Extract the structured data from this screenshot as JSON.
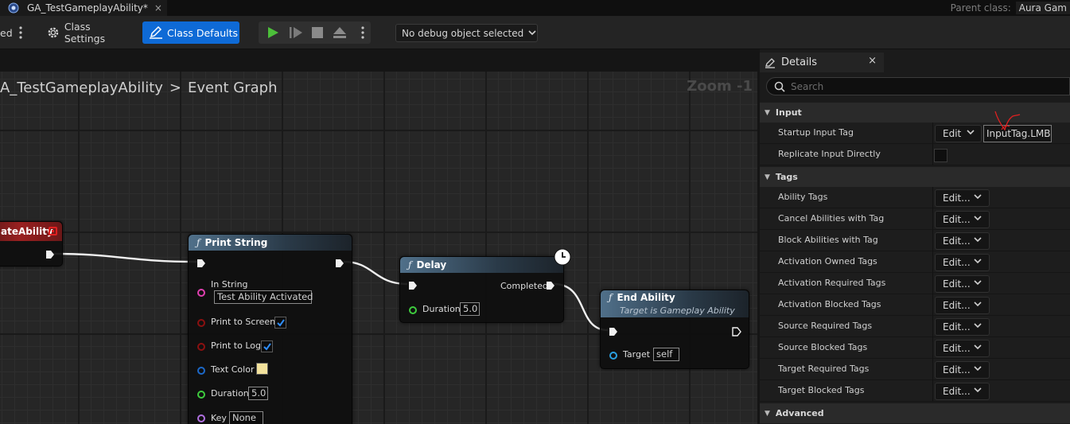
{
  "tab": {
    "title": "GA_TestGameplayAbility*",
    "close": "×"
  },
  "parent_class": {
    "label": "Parent class:",
    "value": "Aura Gam"
  },
  "toolbar": {
    "left_fragment": "ed",
    "class_settings": "Class Settings",
    "class_defaults": "Class Defaults",
    "debug_object": "No debug object selected"
  },
  "graph": {
    "breadcrumb": {
      "asset": "A_TestGameplayAbility",
      "separator": ">",
      "graph_name": "Event Graph"
    },
    "zoom": "Zoom -1",
    "nodes": {
      "event": {
        "title": "ateAbility"
      },
      "print_string": {
        "title": "Print String",
        "in_string_label": "In String",
        "in_string_value": "Test Ability Activated",
        "print_to_screen_label": "Print to Screen",
        "print_to_screen": true,
        "print_to_log_label": "Print to Log",
        "print_to_log": true,
        "text_color_label": "Text Color",
        "text_color": "#f3e29c",
        "duration_label": "Duration",
        "duration_value": "5.0",
        "key_label": "Key",
        "key_value": "None"
      },
      "delay": {
        "title": "Delay",
        "completed_label": "Completed",
        "duration_label": "Duration",
        "duration_value": "5.0"
      },
      "end_ability": {
        "title": "End Ability",
        "subtitle": "Target is Gameplay Ability",
        "target_label": "Target",
        "target_value": "self"
      }
    }
  },
  "details": {
    "tab_label": "Details",
    "close": "×",
    "search_placeholder": "Search",
    "categories": {
      "input": "Input",
      "tags": "Tags",
      "advanced": "Advanced"
    },
    "input_props": {
      "startup_input_tag": {
        "label": "Startup Input Tag",
        "button": "Edit",
        "value": "InputTag.LMB"
      },
      "replicate_input_directly": {
        "label": "Replicate Input Directly",
        "checked": false
      }
    },
    "tag_props": [
      {
        "label": "Ability Tags",
        "button": "Edit..."
      },
      {
        "label": "Cancel Abilities with Tag",
        "button": "Edit..."
      },
      {
        "label": "Block Abilities with Tag",
        "button": "Edit..."
      },
      {
        "label": "Activation Owned Tags",
        "button": "Edit..."
      },
      {
        "label": "Activation Required Tags",
        "button": "Edit..."
      },
      {
        "label": "Activation Blocked Tags",
        "button": "Edit..."
      },
      {
        "label": "Source Required Tags",
        "button": "Edit..."
      },
      {
        "label": "Source Blocked Tags",
        "button": "Edit..."
      },
      {
        "label": "Target Required Tags",
        "button": "Edit..."
      },
      {
        "label": "Target Blocked Tags",
        "button": "Edit..."
      }
    ]
  },
  "colors": {
    "accent_blue": "#0e6ad6",
    "play_green": "#4cbf3a",
    "event_red": "#c02020",
    "pin_string": "#e040b0",
    "pin_bool": "#8b1010",
    "pin_struct": "#1c68c8",
    "pin_float": "#3ecc3e",
    "pin_key": "#b070e0",
    "pin_object": "#2aa0e0",
    "annotation_red": "#e02020"
  },
  "icons": [
    "unreal-logo-icon",
    "gear-icon",
    "pencil-icon",
    "play-icon",
    "step-icon",
    "stop-icon",
    "eject-icon",
    "kebab-icon",
    "chevron-down-icon",
    "function-icon",
    "clock-icon",
    "details-icon",
    "search-icon",
    "checkmark-icon"
  ]
}
